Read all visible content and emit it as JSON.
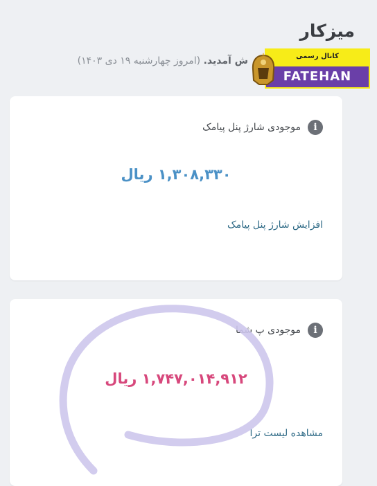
{
  "page": {
    "title": "میزکار",
    "welcome_strong": "ش آمدید.",
    "welcome_date": " (امروز چهارشنبه ۱۹ دی ۱۴۰۳)"
  },
  "watermark": {
    "top_text": "کانال رسمی",
    "brand": "FATEHAN"
  },
  "cards": [
    {
      "title": "موجودی شارژ پنل پیامک",
      "amount": "۱,۳۰۸,۳۳۰ ریال",
      "link": "افزایش شارژ پنل پیامک",
      "accent": "#4b91c6"
    },
    {
      "title": "موجودی پ     شما",
      "amount": "۱,۷۴۷,۰۱۴,۹۱۲ ریال",
      "link": "مشاهده لیست ترا",
      "accent": "#d7487c"
    }
  ],
  "icons": {
    "info": "info-icon"
  },
  "colors": {
    "background": "#eef0f3",
    "card": "#ffffff",
    "scribble": "#cdc6ec"
  }
}
